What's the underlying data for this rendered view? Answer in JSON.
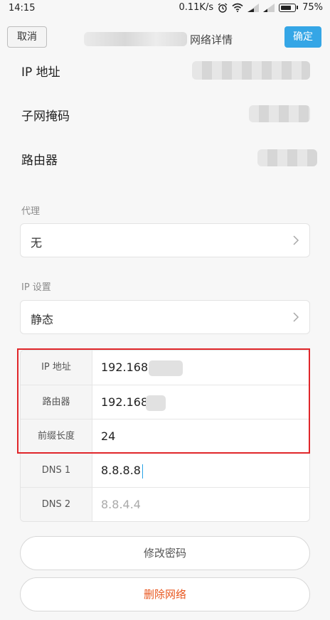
{
  "status_bar": {
    "time": "14:15",
    "speed": "0.11K/s",
    "battery": "75%"
  },
  "header": {
    "cancel_label": "取消",
    "title": "网络详情",
    "confirm_label": "确定"
  },
  "network_info": [
    {
      "label": "IP 地址"
    },
    {
      "label": "子网掩码"
    },
    {
      "label": "路由器"
    }
  ],
  "proxy": {
    "section_label": "代理",
    "value": "无"
  },
  "ip_settings": {
    "section_label": "IP 设置",
    "value": "静态"
  },
  "static_config": [
    {
      "label": "IP 地址",
      "value": "192.168.",
      "placeholder": false
    },
    {
      "label": "路由器",
      "value": "192.168",
      "placeholder": false
    },
    {
      "label": "前缀长度",
      "value": "24",
      "placeholder": false
    },
    {
      "label": "DNS 1",
      "value": "8.8.8.8",
      "placeholder": false
    },
    {
      "label": "DNS 2",
      "value": "8.8.4.4",
      "placeholder": true
    }
  ],
  "actions": {
    "modify_password": "修改密码",
    "delete_network": "删除网络"
  },
  "colors": {
    "accent": "#35a6e6",
    "danger": "#e8571f",
    "highlight_border": "#e0262a"
  }
}
